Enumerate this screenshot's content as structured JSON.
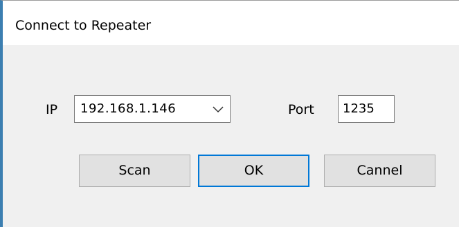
{
  "window": {
    "title": "Connect to Repeater"
  },
  "form": {
    "ip_label": "IP",
    "ip_value": "192.168.1.146",
    "port_label": "Port",
    "port_value": "1235"
  },
  "buttons": {
    "scan": "Scan",
    "ok": "OK",
    "cancel": "Cannel"
  },
  "icons": {
    "combo_arrow": "chevron-down-icon"
  },
  "colors": {
    "accent": "#0078d7",
    "window_border": "#3c7fb1",
    "dialog_background": "#f0f0f0",
    "button_background": "#e1e1e1"
  }
}
